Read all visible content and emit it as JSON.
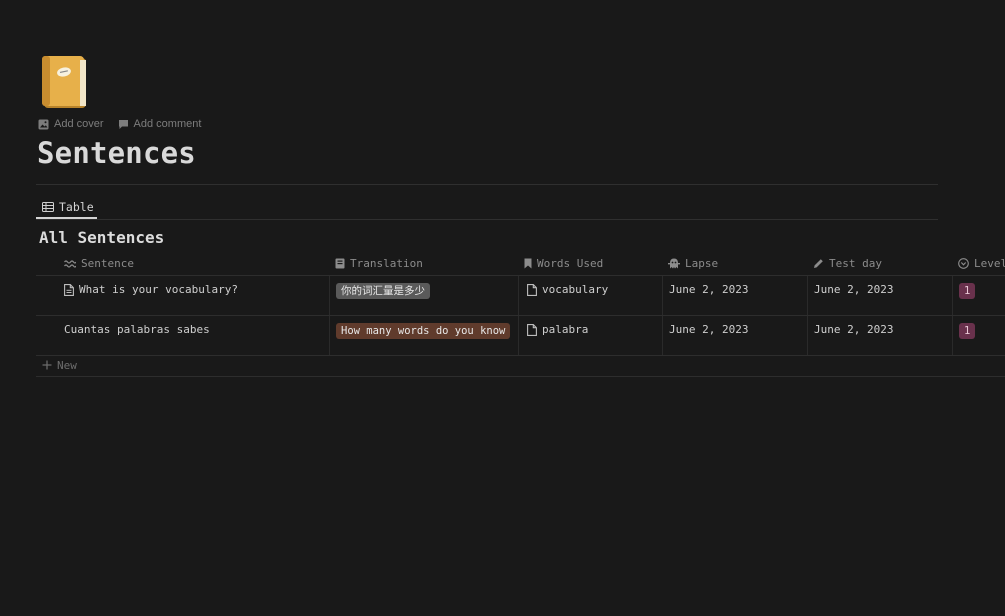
{
  "page": {
    "icon": "notebook-icon",
    "add_cover": "Add cover",
    "add_comment": "Add comment",
    "title": "Sentences"
  },
  "views": [
    {
      "label": "Table",
      "icon": "table-icon"
    }
  ],
  "database": {
    "title": "All Sentences",
    "columns": [
      {
        "label": "Sentence",
        "icon": "waves-icon"
      },
      {
        "label": "Translation",
        "icon": "book-icon"
      },
      {
        "label": "Words Used",
        "icon": "bookmark-icon"
      },
      {
        "label": "Lapse",
        "icon": "ghost-icon"
      },
      {
        "label": "Test day",
        "icon": "pencil-icon"
      },
      {
        "label": "Level",
        "icon": "circle-chevron-icon"
      }
    ],
    "rows": [
      {
        "sentence": "What is your vocabulary?",
        "translation": "你的词汇量是多少",
        "translation_color": "#5a5a5a",
        "words_used": "vocabulary",
        "lapse": "June 2, 2023",
        "test_day": "June 2, 2023",
        "level": "1"
      },
      {
        "sentence": "Cuantas palabras sabes",
        "translation": "How many words do you know",
        "translation_color": "#603b2c",
        "words_used": "palabra",
        "lapse": "June 2, 2023",
        "test_day": "June 2, 2023",
        "level": "1"
      }
    ],
    "new_label": "New"
  },
  "colors": {
    "background": "#191919",
    "text": "#d4d4d4",
    "muted": "#8c8c8c",
    "level_tag": "#69314c"
  }
}
